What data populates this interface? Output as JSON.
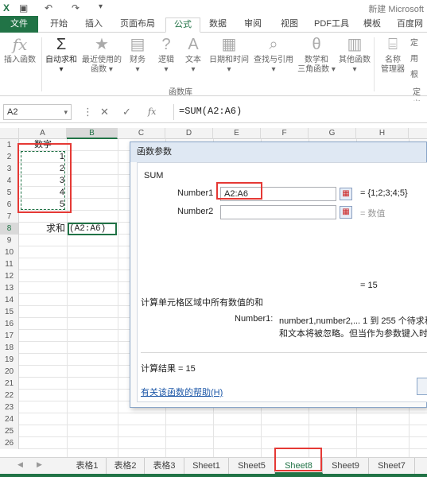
{
  "title_bar": {
    "doc_title": "新建 Microsoft",
    "save_icon": "save-icon",
    "undo_icon": "undo-icon",
    "redo_icon": "redo-icon"
  },
  "tabs": [
    {
      "label": "文件"
    },
    {
      "label": "开始"
    },
    {
      "label": "插入"
    },
    {
      "label": "页面布局"
    },
    {
      "label": "公式"
    },
    {
      "label": "数据"
    },
    {
      "label": "审阅"
    },
    {
      "label": "视图"
    },
    {
      "label": "PDF工具"
    },
    {
      "label": "模板"
    },
    {
      "label": "百度网"
    }
  ],
  "ribbon": {
    "insert_function": "插入函数",
    "autosum": "自动求和",
    "recent_l1": "最近使用的",
    "recent_l2": "函数",
    "financial": "财务",
    "logical": "逻辑",
    "text": "文本",
    "datetime": "日期和时间",
    "lookup": "查找与引用",
    "math_l1": "数学和",
    "math_l2": "三角函数",
    "other": "其他函数",
    "name_mgr_l1": "名称",
    "name_mgr_l2": "管理器",
    "group_label": "函数库",
    "group_label2": "定义",
    "define_1": "定",
    "define_2": "用",
    "define_3": "根"
  },
  "formula_bar": {
    "name_box": "A2",
    "formula": "=SUM(A2:A6)"
  },
  "grid": {
    "columns": [
      "A",
      "B",
      "C",
      "D",
      "E",
      "F",
      "G",
      "H"
    ],
    "rows": [
      "1",
      "2",
      "3",
      "4",
      "5",
      "6",
      "7",
      "8",
      "9",
      "10",
      "11",
      "12",
      "13",
      "14",
      "15",
      "16",
      "17",
      "18",
      "19",
      "20",
      "21",
      "22",
      "23",
      "24",
      "25",
      "26"
    ],
    "a1": "数字",
    "a2": "1",
    "a3": "2",
    "a4": "3",
    "a5": "4",
    "a6": "5",
    "a8": "求和",
    "b8": "(A2:A6)"
  },
  "dialog": {
    "title": "函数参数",
    "function_name": "SUM",
    "number1_label": "Number1",
    "number1_value": "A2:A6",
    "number1_result": "= {1;2;3;4;5}",
    "number2_label": "Number2",
    "number2_value": "",
    "number2_result": "= 数值",
    "result_eq": "= 15",
    "description": "计算单元格区域中所有数值的和",
    "arg_desc_label": "Number1:",
    "arg_desc_1": "number1,number2,... 1 到 255 个待求和",
    "arg_desc_2": "和文本将被忽略。但当作为参数键入时，逻",
    "calc_result": "计算结果 =   15",
    "help_link": "有关该函数的帮助(H)"
  },
  "sheets": [
    {
      "label": "表格1"
    },
    {
      "label": "表格2"
    },
    {
      "label": "表格3"
    },
    {
      "label": "Sheet1"
    },
    {
      "label": "Sheet5"
    },
    {
      "label": "Sheet8"
    },
    {
      "label": "Sheet9"
    },
    {
      "label": "Sheet7"
    }
  ],
  "colors": {
    "accent": "#217346",
    "highlight": "#e53935"
  }
}
